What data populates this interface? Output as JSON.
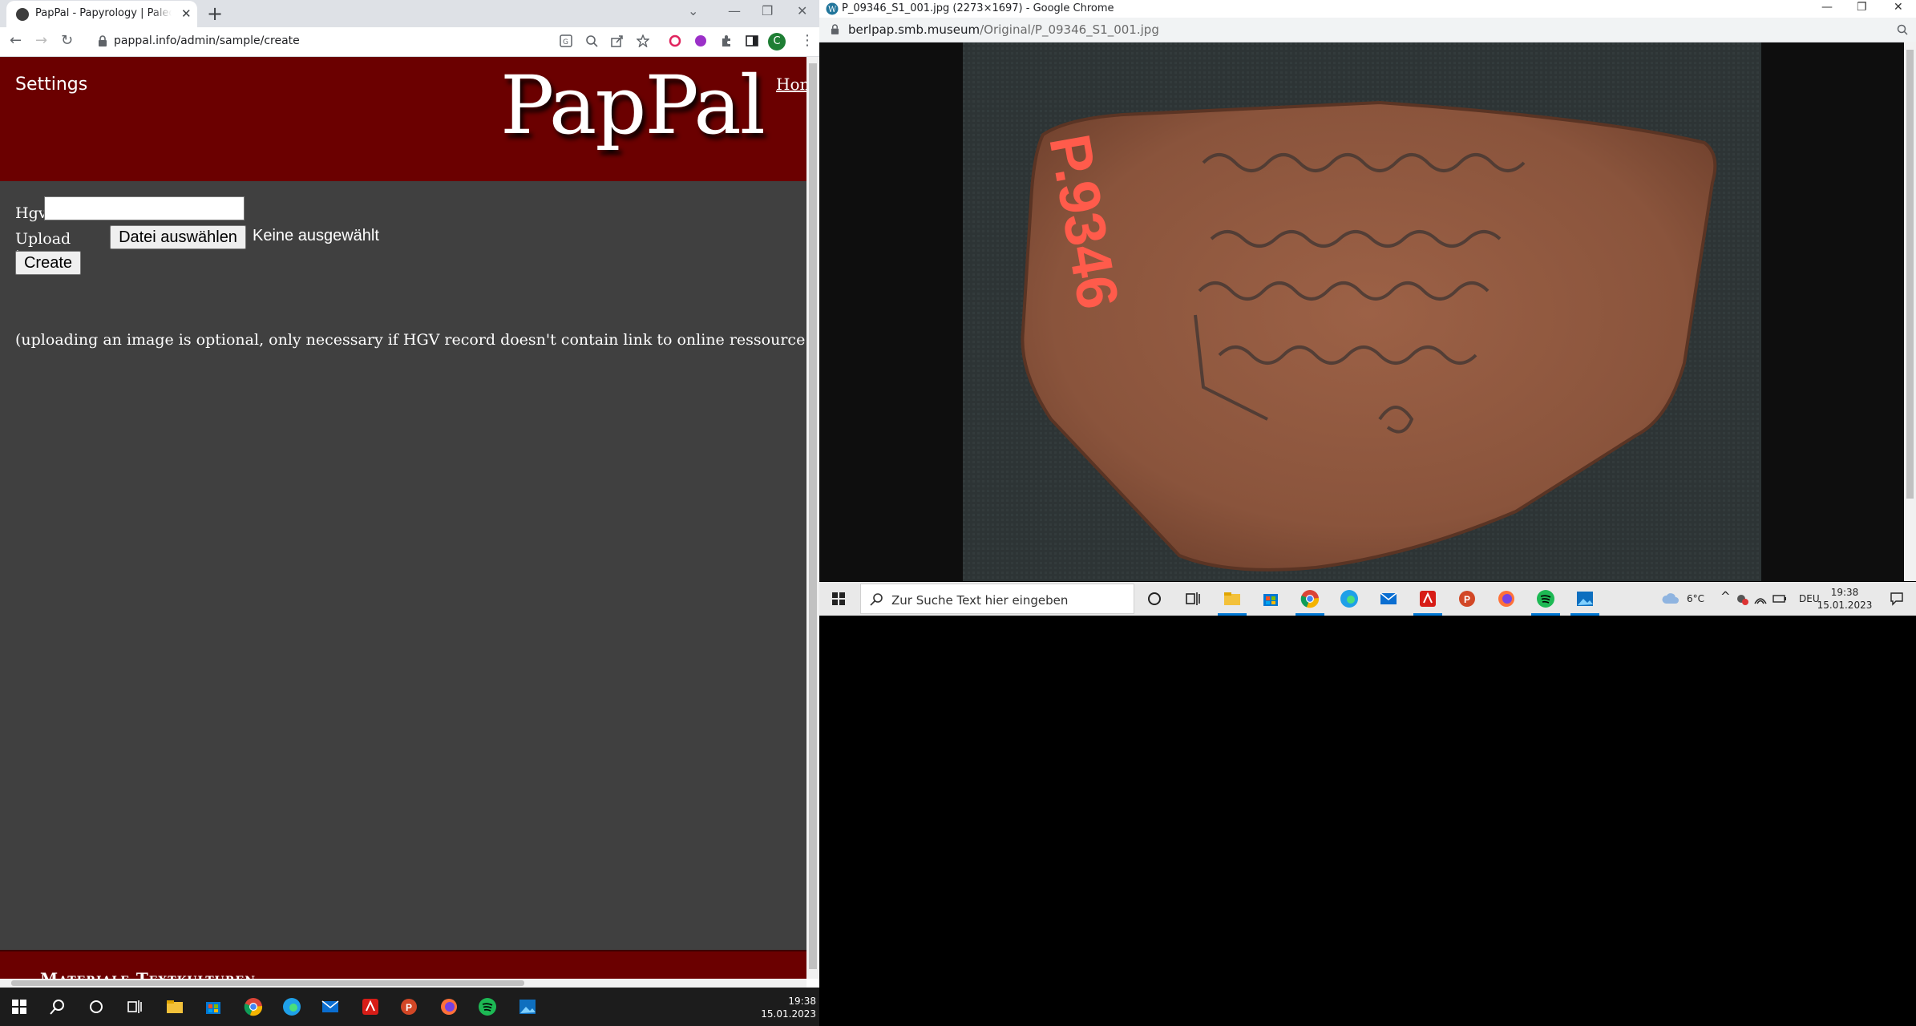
{
  "left_window": {
    "tab_title": "PapPal - Papyrology | Paleography",
    "url": "pappal.info/admin/sample/create",
    "profile_initial": "C"
  },
  "page": {
    "settings_link": "Settings",
    "logo": "PapPal",
    "home_link": "Home",
    "hgv_label": "Hgv",
    "upload_label": "Upload image",
    "file_button": "Datei auswählen",
    "file_status": "Keine ausgewählt",
    "create_button": "Create",
    "hint": "(uploading an image is optional, only necessary if HGV record doesn't contain link to online ressource or if online archive",
    "footer_title": "Materiale Textkulturen"
  },
  "left_taskbar": {
    "time": "19:38",
    "date": "15.01.2023"
  },
  "right_window": {
    "title": "P_09346_S1_001.jpg (2273×1697) - Google Chrome",
    "url_host": "berlpap.smb.museum",
    "url_path": "/Original/P_09346_S1_001.jpg",
    "ostracon_label": "P.9346"
  },
  "right_taskbar": {
    "search_placeholder": "Zur Suche Text hier eingeben",
    "weather": "6°C",
    "language": "DEU",
    "time": "19:38",
    "date": "15.01.2023"
  },
  "colors": {
    "header_bg": "#6b0000",
    "page_bg": "#404040",
    "accent": "#0078d4"
  }
}
